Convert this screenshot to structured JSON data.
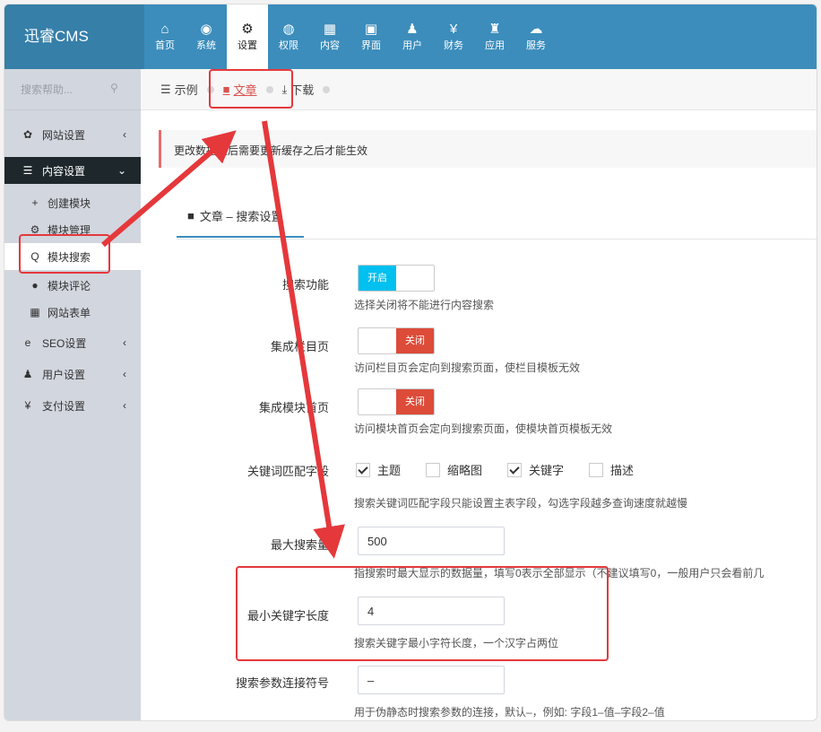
{
  "logo": "迅睿CMS",
  "top_nav": [
    {
      "icon": "home-icon",
      "glyph": "⌂",
      "label": "首页"
    },
    {
      "icon": "globe-icon",
      "glyph": "◉",
      "label": "系统"
    },
    {
      "icon": "cogs-icon",
      "glyph": "⚙",
      "label": "设置",
      "active": true
    },
    {
      "icon": "user-circle-icon",
      "glyph": "◍",
      "label": "权限"
    },
    {
      "icon": "grid-icon",
      "glyph": "▦",
      "label": "内容"
    },
    {
      "icon": "html5-icon",
      "glyph": "▣",
      "label": "界面"
    },
    {
      "icon": "user-icon",
      "glyph": "♟",
      "label": "用户"
    },
    {
      "icon": "yen-icon",
      "glyph": "¥",
      "label": "财务"
    },
    {
      "icon": "sitemap-icon",
      "glyph": "♜",
      "label": "应用"
    },
    {
      "icon": "cloud-icon",
      "glyph": "☁",
      "label": "服务"
    }
  ],
  "sidebar": {
    "search_placeholder": "搜索帮助...",
    "items": [
      {
        "icon": "gear-icon",
        "glyph": "✿",
        "label": "网站设置",
        "chevron": "‹"
      },
      {
        "icon": "list-icon",
        "glyph": "☰",
        "label": "内容设置",
        "chevron": "⌄",
        "open": true
      },
      {
        "icon": "plus-icon",
        "glyph": "+",
        "label": "创建模块",
        "sub": true
      },
      {
        "icon": "cogs-icon",
        "glyph": "⚙",
        "label": "模块管理",
        "sub": true
      },
      {
        "icon": "search-icon",
        "glyph": "Q",
        "label": "模块搜索",
        "sub": true,
        "selected": true
      },
      {
        "icon": "comments-icon",
        "glyph": "●",
        "label": "模块评论",
        "sub": true
      },
      {
        "icon": "table-icon",
        "glyph": "▦",
        "label": "网站表单",
        "sub": true
      },
      {
        "icon": "ie-icon",
        "glyph": "e",
        "label": "SEO设置",
        "chevron": "‹"
      },
      {
        "icon": "user-icon",
        "glyph": "♟",
        "label": "用户设置",
        "chevron": "‹"
      },
      {
        "icon": "yen-icon",
        "glyph": "¥",
        "label": "支付设置",
        "chevron": "‹"
      }
    ]
  },
  "tabs": [
    {
      "icon": "list-icon",
      "glyph": "☰",
      "label": "示例"
    },
    {
      "icon": "doc-icon",
      "glyph": "■",
      "label": "文章",
      "active": true
    },
    {
      "icon": "download-icon",
      "glyph": "⤓",
      "label": "下载"
    }
  ],
  "notice": "更改数据之后需要更新缓存之后才能生效",
  "panel_tab": {
    "icon": "doc-icon",
    "glyph": "■",
    "label": "文章 – 搜索设置"
  },
  "form": {
    "search_enable": {
      "label": "搜索功能",
      "state_label": "开启",
      "help": "选择关闭将不能进行内容搜索"
    },
    "merge_category": {
      "label": "集成栏目页",
      "state_label": "关闭",
      "help": "访问栏目页会定向到搜索页面，使栏目模板无效"
    },
    "merge_module_index": {
      "label": "集成模块首页",
      "state_label": "关闭",
      "help": "访问模块首页会定向到搜索页面，使模块首页模板无效"
    },
    "keyword_fields": {
      "label": "关键词匹配字段",
      "options": [
        {
          "label": "主题",
          "checked": true
        },
        {
          "label": "缩略图",
          "checked": false
        },
        {
          "label": "关键字",
          "checked": true
        },
        {
          "label": "描述",
          "checked": false
        }
      ],
      "help": "搜索关键词匹配字段只能设置主表字段，勾选字段越多查询速度就越慢"
    },
    "max_results": {
      "label": "最大搜索量",
      "value": "500",
      "help": "指搜索时最大显示的数据量，填写0表示全部显示（不建议填写0，一般用户只会看前几"
    },
    "min_keyword_len": {
      "label": "最小关键字长度",
      "value": "4",
      "help": "搜索关键字最小字符长度，一个汉字占两位"
    },
    "param_separator": {
      "label": "搜索参数连接符号",
      "value": "–",
      "help": "用于伪静态时搜索参数的连接，默认–，例如: 字段1–值–字段2–值"
    }
  }
}
